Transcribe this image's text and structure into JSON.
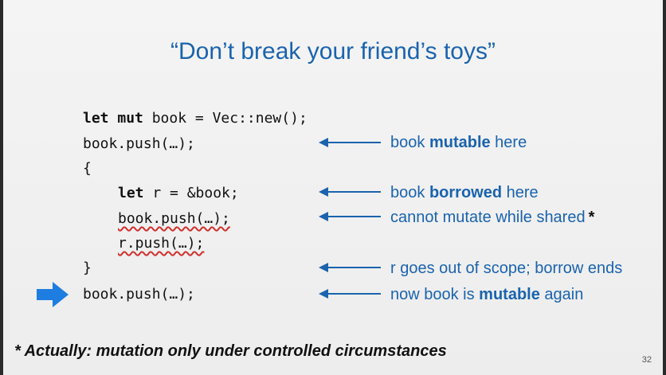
{
  "slide": {
    "title": "“Don’t break your friend’s toys”",
    "code": {
      "line1_kw1": "let",
      "line1_kw2": "mut",
      "line1_rest": " book = Vec::new();",
      "line2": "book.push(…);",
      "line3": "{",
      "line4_kw": "let",
      "line4_rest": " r = &book;",
      "line5": "book.push(…);",
      "line6": "r.push(…);",
      "line7": "}",
      "line8": "book.push(…);"
    },
    "notes": {
      "n1_pre": "book ",
      "n1_bold": "mutable",
      "n1_post": " here",
      "n2_pre": "book ",
      "n2_bold": "borrowed",
      "n2_post": " here",
      "n3": "cannot mutate while shared",
      "n3_star": "*",
      "n4": "r goes out of scope; borrow ends",
      "n5_pre": "now book is ",
      "n5_bold": "mutable",
      "n5_post": " again"
    },
    "footnote": "* Actually: mutation only under controlled circumstances",
    "page_number": "32"
  },
  "colors": {
    "accent": "#1a63ad",
    "arrow": "#1a63ad",
    "big_arrow": "#1e7de0",
    "squiggle": "#d0312d"
  }
}
